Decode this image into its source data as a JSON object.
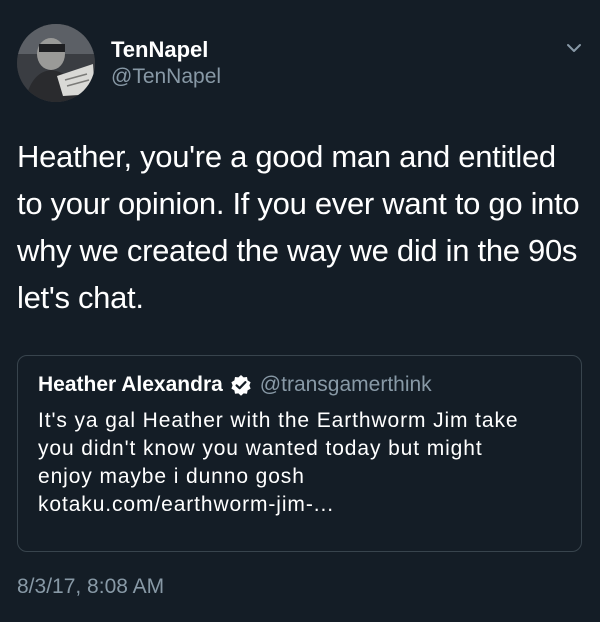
{
  "author": {
    "display_name": "TenNapel",
    "handle": "@TenNapel"
  },
  "tweet": {
    "text": "Heather, you're a good man and entitled to your opinion. If you ever want to go into why we created the way we did in the 90s let's chat.",
    "timestamp": "8/3/17, 8:08 AM"
  },
  "quoted_tweet": {
    "display_name": "Heather Alexandra",
    "handle": "@transgamerthink",
    "verified": true,
    "lines": [
      "It's ya gal Heather with the Earthworm Jim take",
      "you didn't know you wanted today but might",
      "enjoy maybe i dunno gosh",
      "kotaku.com/earthworm-jim-..."
    ]
  },
  "icons": {
    "menu": "chevron-down-icon",
    "verified": "verified-badge-icon"
  },
  "colors": {
    "background": "#141d26",
    "primary_text": "#ffffff",
    "secondary_text": "#8899a6",
    "border": "#38444d"
  }
}
